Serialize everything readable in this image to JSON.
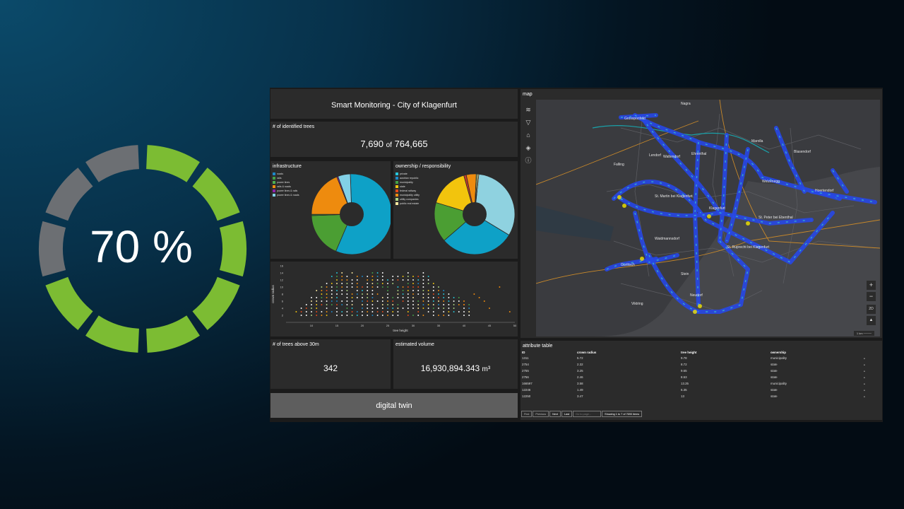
{
  "progress": {
    "label": "70 %",
    "value": 0.7,
    "segments": 10,
    "filled_color": "#7cbc33",
    "empty_color": "#6c6f73"
  },
  "dashboard": {
    "title": "Smart Monitoring - City of Klagenfurt",
    "identified": {
      "label": "# of identified trees",
      "count": "7,690",
      "of": "of",
      "total": "764,665"
    },
    "infrastructure": {
      "title": "infrastructure",
      "legend": [
        "roads",
        "rails",
        "power lines",
        "rails & roads",
        "power lines & rails",
        "power lines & roads"
      ],
      "colors": [
        "#1e88c8",
        "#43a047",
        "#4caf50",
        "#ef8c10",
        "#8e24aa",
        "#82d0e6"
      ]
    },
    "ownership": {
      "title": "ownership / responsibility",
      "legend": [
        "private",
        "austrian republic",
        "municipality",
        "state",
        "federal railway",
        "municipality utility",
        "utility companies",
        "public real estate"
      ],
      "colors": [
        "#26c6da",
        "#1e88c8",
        "#43a047",
        "#f1c40f",
        "#e64a19",
        "#ef8c10",
        "#aed581",
        "#f9e79f"
      ]
    },
    "scatter": {
      "ylabel": "crown radius",
      "xlabel": "tree height",
      "xticks": [
        "10",
        "15",
        "20",
        "25",
        "30",
        "35",
        "40",
        "45",
        "50"
      ],
      "yticks": [
        "16",
        "14",
        "12",
        "10",
        "8",
        "6",
        "4",
        "2"
      ]
    },
    "above30": {
      "label": "# of trees above 30m",
      "value": "342"
    },
    "volume": {
      "label": "estimated volume",
      "value": "16,930,894.343",
      "unit": "m³"
    },
    "twin_button": "digital twin",
    "map": {
      "title": "map",
      "tools": [
        "layers-icon",
        "filter-icon",
        "basemap-icon",
        "locate-icon",
        "info-icon"
      ],
      "places": [
        "Nagra",
        "Grossponfeld",
        "Lendorf",
        "Marolla",
        "Blasendorf",
        "Waltendorf",
        "Ehrenthal",
        "Welzenegg",
        "Falling",
        "St. Martin bei Klagenfurt",
        "Klagenfurt",
        "St. Peter bei Ebenthal",
        "Hoertendorf",
        "Waidmannsdorf",
        "St. Ruprecht bei Klagenfurt",
        "Gurlitsch",
        "Viktring",
        "Stein",
        "Neudorf"
      ],
      "zoom_in": "+",
      "zoom_out": "−",
      "mode": "2D",
      "north": "▲",
      "scale": "1 km"
    },
    "attr_table": {
      "title": "attribute table",
      "headers": [
        "ID",
        "crown radius",
        "tree height",
        "ownership"
      ],
      "rows": [
        [
          "1311",
          "5.72",
          "9.78",
          "municipality"
        ],
        [
          "2754",
          "2.32",
          "8.72",
          "state"
        ],
        [
          "2755",
          "3.25",
          "9.65",
          "state"
        ],
        [
          "2756",
          "2.46",
          "8.53",
          "state"
        ],
        [
          "166597",
          "3.58",
          "13.25",
          "municipality"
        ],
        [
          "12246",
          "1.49",
          "6.35",
          "state"
        ],
        [
          "12250",
          "3.47",
          "13",
          "state"
        ]
      ],
      "pager": {
        "first": "First",
        "prev": "Previous",
        "next": "Next",
        "last": "Last",
        "goto": "Go to page...",
        "summary": "Showing 1 to 7 of 7690 items"
      }
    }
  },
  "chart_data": [
    {
      "type": "pie",
      "title": "infrastructure",
      "categories": [
        "roads",
        "rails",
        "power lines",
        "rails & roads",
        "power lines & rails",
        "power lines & roads"
      ],
      "values": [
        57,
        18,
        0.5,
        19,
        0.5,
        5
      ]
    },
    {
      "type": "pie",
      "title": "ownership / responsibility",
      "categories": [
        "private",
        "austrian republic",
        "municipality",
        "state",
        "federal railway",
        "municipality utility",
        "utility companies",
        "public real estate"
      ],
      "values": [
        32,
        30,
        16,
        16,
        1,
        4,
        0.5,
        0.5
      ]
    },
    {
      "type": "scatter",
      "xlabel": "tree height",
      "ylabel": "crown radius",
      "xlim": [
        5,
        50
      ],
      "ylim": [
        0,
        16
      ]
    }
  ]
}
